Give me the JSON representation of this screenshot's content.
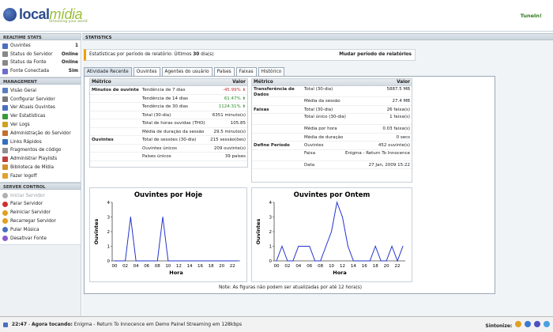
{
  "header": {
    "logo_main": "local",
    "logo_accent": "mídia",
    "logo_tagline": "Streaming your world",
    "tunein_label": "TuneIn!"
  },
  "sidebar": {
    "realtime_title": "REALTIME STATS",
    "realtime_items": [
      {
        "label": "Ouvintes",
        "value": "1",
        "icon": "listeners-icon",
        "color": "#4a6fbf"
      },
      {
        "label": "Status do Servidor",
        "value": "Online",
        "icon": "server-status-icon",
        "color": "#888888"
      },
      {
        "label": "Status da Fonte",
        "value": "Online",
        "icon": "source-status-icon",
        "color": "#888888"
      },
      {
        "label": "Fonte Conectada",
        "value": "Sim",
        "icon": "speaker-icon",
        "color": "#6b6bd0"
      }
    ],
    "management_title": "MANAGEMENT",
    "management_items": [
      {
        "label": "Visão Geral",
        "icon": "overview-icon",
        "color": "#5a7fc0"
      },
      {
        "label": "Configurar Servidor",
        "icon": "settings-icon",
        "color": "#7a7a7a"
      },
      {
        "label": "Ver Atuais Ouvintes",
        "icon": "listeners-list-icon",
        "color": "#4a6fbf"
      },
      {
        "label": "Ver Estatísticas",
        "icon": "statistics-icon",
        "color": "#3a9a3a"
      },
      {
        "label": "Ver Logs",
        "icon": "logs-icon",
        "color": "#d0a020"
      },
      {
        "label": "Administração do Servidor",
        "icon": "admin-icon",
        "color": "#c07030"
      },
      {
        "label": "Links Rápidos",
        "icon": "links-icon",
        "color": "#3070c0"
      },
      {
        "label": "Fragmentos de código",
        "icon": "code-icon",
        "color": "#909090"
      },
      {
        "label": "Administrar Playlists",
        "icon": "playlist-icon",
        "color": "#c04040"
      },
      {
        "label": "Biblioteca de Mídia",
        "icon": "library-icon",
        "color": "#d09030"
      },
      {
        "label": "Fazer logoff",
        "icon": "logoff-icon",
        "color": "#e0a030"
      }
    ],
    "server_control_title": "SERVER CONTROL",
    "server_control_items": [
      {
        "label": "Iniciar Servidor",
        "icon": "play-icon",
        "color": "#b0b0b0",
        "disabled": true
      },
      {
        "label": "Parar Servidor",
        "icon": "stop-icon",
        "color": "#d03030",
        "disabled": false
      },
      {
        "label": "Reiniciar Servidor",
        "icon": "restart-icon",
        "color": "#e0a020",
        "disabled": false
      },
      {
        "label": "Recarregar Servidor",
        "icon": "reload-icon",
        "color": "#e0a020",
        "disabled": false
      },
      {
        "label": "Pular Música",
        "icon": "skip-icon",
        "color": "#4a6fbf",
        "disabled": false
      },
      {
        "label": "Desativar Fonte",
        "icon": "disable-source-icon",
        "color": "#8a5ad0",
        "disabled": false
      }
    ]
  },
  "main": {
    "title": "STATISTICS",
    "period_prefix": "Estatísticas por período de relatório: Últimos",
    "period_value": "30",
    "period_suffix": "dia(s)",
    "period_link": "Mudar período de relatórios",
    "tabs": [
      "Atividade Recente",
      "Ouvintes",
      "Agentes do usuário",
      "Países",
      "Faixas",
      "Histórico"
    ],
    "left_table": {
      "col_metric": "Métrico",
      "col_value": "Valor",
      "rows": [
        {
          "group": "Minutos de ouvinte",
          "label": "Tendência de 7 dias",
          "value": "-45.99%",
          "trend": "down"
        },
        {
          "group": "",
          "label": "Tendência de 14 dias",
          "value": "61.47%",
          "trend": "up"
        },
        {
          "group": "",
          "label": "Tendência de 30 dias",
          "value": "1124.31%",
          "trend": "up"
        },
        {
          "group": "",
          "label": "Total (30-dia)",
          "value": "6351 minuto(s)",
          "trend": ""
        },
        {
          "group": "",
          "label": "Total de horas ouvidas (THO)",
          "value": "105.85",
          "trend": ""
        },
        {
          "group": "",
          "label": "Média de duração da sessão",
          "value": "29.5 minuto(s)",
          "trend": ""
        },
        {
          "group": "Ouvintes",
          "label": "Total de sessões (30-dia)",
          "value": "215 sessão(ões)",
          "trend": ""
        },
        {
          "group": "",
          "label": "Ouvintes únicos",
          "value": "209 ouvinte(s)",
          "trend": ""
        },
        {
          "group": "",
          "label": "Países únicos",
          "value": "39 países",
          "trend": ""
        }
      ]
    },
    "right_table": {
      "col_metric": "Métrico",
      "col_value": "Valor",
      "rows": [
        {
          "group": "Transferência de Dados",
          "label": "Total (30-dia)",
          "value": "5887.5 MB",
          "tall": true
        },
        {
          "group": "",
          "label": "Média da sessão",
          "value": "27.4 MB",
          "tall": false
        },
        {
          "group": "Faixas",
          "label": "Total (30-dia)",
          "value": "26 faixa(s)",
          "tall": false
        },
        {
          "group": "",
          "label": "Total único (30-dia)",
          "value": "1 faixa(s)",
          "tall": true
        },
        {
          "group": "",
          "label": "Média por hora",
          "value": "0.03 faixa(s)",
          "tall": false
        },
        {
          "group": "",
          "label": "Média de duração",
          "value": "0 secs",
          "tall": false
        },
        {
          "group": "Define Período",
          "label": "Ouvintes",
          "value": "452 ouvinte(s)",
          "tall": false
        },
        {
          "group": "",
          "label": "Faixa",
          "value": "Enigma - Return To Innocence",
          "tall": true
        },
        {
          "group": "",
          "label": "Data",
          "value": "27 Jan, 2009 15:22",
          "tall": false
        }
      ]
    },
    "note": "Note: As figuras não podem ser atualizadas por até 12 hora(s)"
  },
  "chart_data": [
    {
      "type": "line",
      "title": "Ouvintes por Hoje",
      "xlabel": "Hora",
      "ylabel": "Ouvintes",
      "x_ticks": [
        "00",
        "02",
        "04",
        "06",
        "08",
        "10",
        "12",
        "14",
        "16",
        "18",
        "20",
        "22"
      ],
      "ylim": [
        0,
        4
      ],
      "y_ticks": [
        0,
        1,
        2,
        3,
        4
      ],
      "series": [
        {
          "values": [
            0,
            0,
            0,
            3,
            0,
            0,
            0,
            0,
            0,
            3,
            0,
            0,
            0,
            0,
            0,
            0,
            0,
            0,
            0,
            0,
            0,
            0,
            0,
            0
          ],
          "color": "#2233cc"
        }
      ]
    },
    {
      "type": "line",
      "title": "Ouvintes por Ontem",
      "xlabel": "Hora",
      "ylabel": "Ouvintes",
      "x_ticks": [
        "00",
        "02",
        "04",
        "06",
        "08",
        "10",
        "12",
        "14",
        "16",
        "18",
        "20",
        "22"
      ],
      "ylim": [
        0,
        4
      ],
      "y_ticks": [
        0,
        1,
        2,
        3,
        4
      ],
      "series": [
        {
          "values": [
            0,
            1,
            0,
            0,
            1,
            1,
            1,
            0,
            0,
            1,
            2,
            4,
            3,
            1,
            0,
            0,
            0,
            0,
            1,
            0,
            0,
            1,
            0,
            1
          ],
          "color": "#2233cc"
        }
      ]
    }
  ],
  "statusbar": {
    "time": "22:47",
    "now_playing_label": "Agora tocando:",
    "now_playing_text": "Enigma - Return To Innocence em Demo Painel Streaming em 128kbps",
    "tunein_label": "Sintonize:"
  }
}
